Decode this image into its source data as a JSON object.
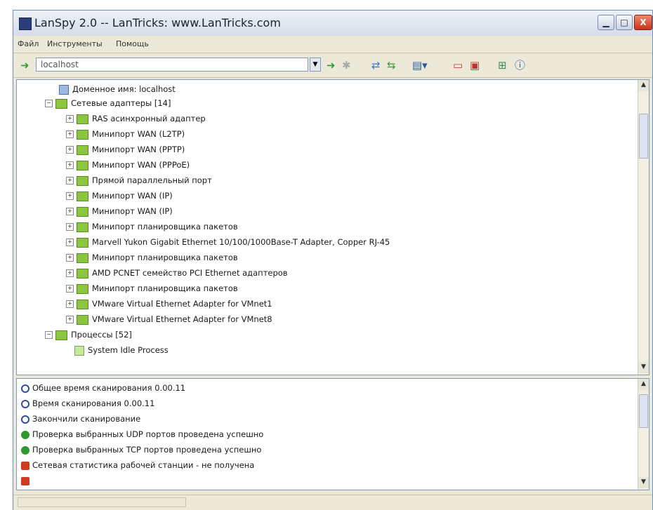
{
  "window": {
    "title": "LanSpy 2.0 -- LanTricks: www.LanTricks.com",
    "buttons": {
      "minimize": "▁",
      "maximize": "□",
      "close": "X"
    }
  },
  "menu": [
    "Файл",
    "Инструменты",
    "Помощь"
  ],
  "toolbar": {
    "address_value": "localhost",
    "icons": [
      "go-arrow-icon",
      "forward-icon",
      "stop-icon",
      "scan-icon",
      "scan-ports-icon",
      "view-menu-icon",
      "page-icon",
      "report-icon",
      "network-icon",
      "info-icon"
    ]
  },
  "tree": {
    "items": [
      {
        "label": "Доменное имя: localhost"
      },
      {
        "label": "Сетевые адаптеры [14]"
      },
      {
        "label": "RAS асинхронный адаптер"
      },
      {
        "label": "Минипорт WAN (L2TP)"
      },
      {
        "label": "Минипорт WAN (PPTP)"
      },
      {
        "label": "Минипорт WAN (PPPoE)"
      },
      {
        "label": "Прямой параллельный порт"
      },
      {
        "label": "Минипорт WAN (IP)"
      },
      {
        "label": "Минипорт WAN (IP)"
      },
      {
        "label": "Минипорт планировщика пакетов"
      },
      {
        "label": "Marvell Yukon Gigabit Ethernet 10/100/1000Base-T Adapter, Copper RJ-45"
      },
      {
        "label": "Минипорт планировщика пакетов"
      },
      {
        "label": "AMD PCNET семейство PCI Ethernet адаптеров"
      },
      {
        "label": "Минипорт планировщика пакетов"
      },
      {
        "label": "VMware Virtual Ethernet Adapter for VMnet1"
      },
      {
        "label": "VMware Virtual Ethernet Adapter for VMnet8"
      },
      {
        "label": "Процессы [52]"
      },
      {
        "label": "System Idle Process"
      }
    ]
  },
  "log": {
    "items": [
      {
        "label": "Общее время сканирования 0.00.11",
        "status": "info",
        "color": "#2a4f9c"
      },
      {
        "label": "Время сканирования 0.00.11",
        "status": "info",
        "color": "#2a4f9c"
      },
      {
        "label": "Закончили сканирование",
        "status": "info",
        "color": "#2a4f9c"
      },
      {
        "label": "Проверка выбранных UDP портов проведена успешно",
        "status": "success",
        "color": "#2e9a2e"
      },
      {
        "label": "Проверка выбранных TCP портов проведена успешно",
        "status": "success",
        "color": "#2e9a2e"
      },
      {
        "label": "Сетевая статистика рабочей станции - не получена",
        "status": "error",
        "color": "#d03a20"
      }
    ]
  },
  "scrollbars": {
    "up": "▲",
    "down": "▼"
  }
}
